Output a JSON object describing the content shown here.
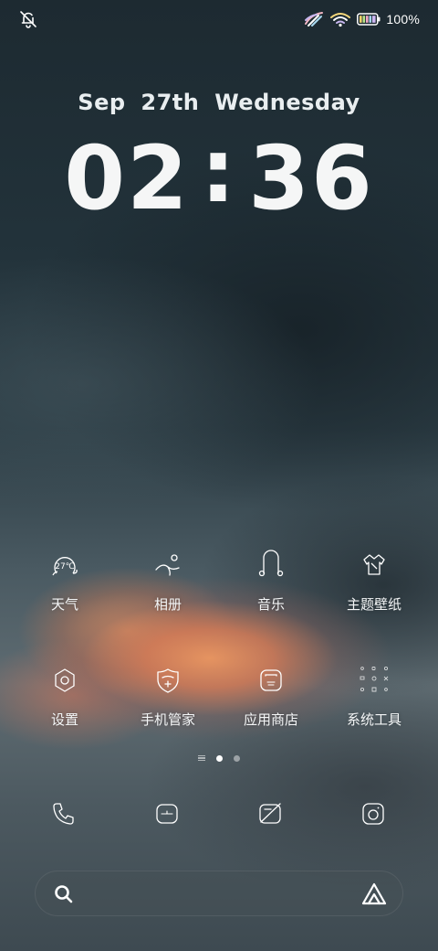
{
  "status_bar": {
    "battery_percent": "100%",
    "icons": [
      "mute-bell-icon",
      "cellular-signal-icon",
      "wifi-icon",
      "battery-icon"
    ]
  },
  "lockscreen": {
    "date": "Sep  27th  Wednesday",
    "time_hours": "02",
    "time_separator": ":",
    "time_minutes": "36"
  },
  "apps": [
    {
      "label": "天气",
      "icon": "weather-icon",
      "icon_text": "27℃"
    },
    {
      "label": "相册",
      "icon": "gallery-icon"
    },
    {
      "label": "音乐",
      "icon": "music-icon"
    },
    {
      "label": "主题壁纸",
      "icon": "themes-icon"
    },
    {
      "label": "设置",
      "icon": "settings-icon"
    },
    {
      "label": "手机管家",
      "icon": "phone-manager-icon"
    },
    {
      "label": "应用商店",
      "icon": "app-store-icon"
    },
    {
      "label": "系统工具",
      "icon": "system-tools-folder-icon"
    }
  ],
  "pager": {
    "pages": 2,
    "active_index": 0
  },
  "dock": [
    {
      "icon": "phone-icon"
    },
    {
      "icon": "messages-icon"
    },
    {
      "icon": "browser-icon"
    },
    {
      "icon": "camera-icon"
    }
  ],
  "search": {
    "search_icon": "search-icon",
    "assistant_icon": "assistant-icon"
  }
}
